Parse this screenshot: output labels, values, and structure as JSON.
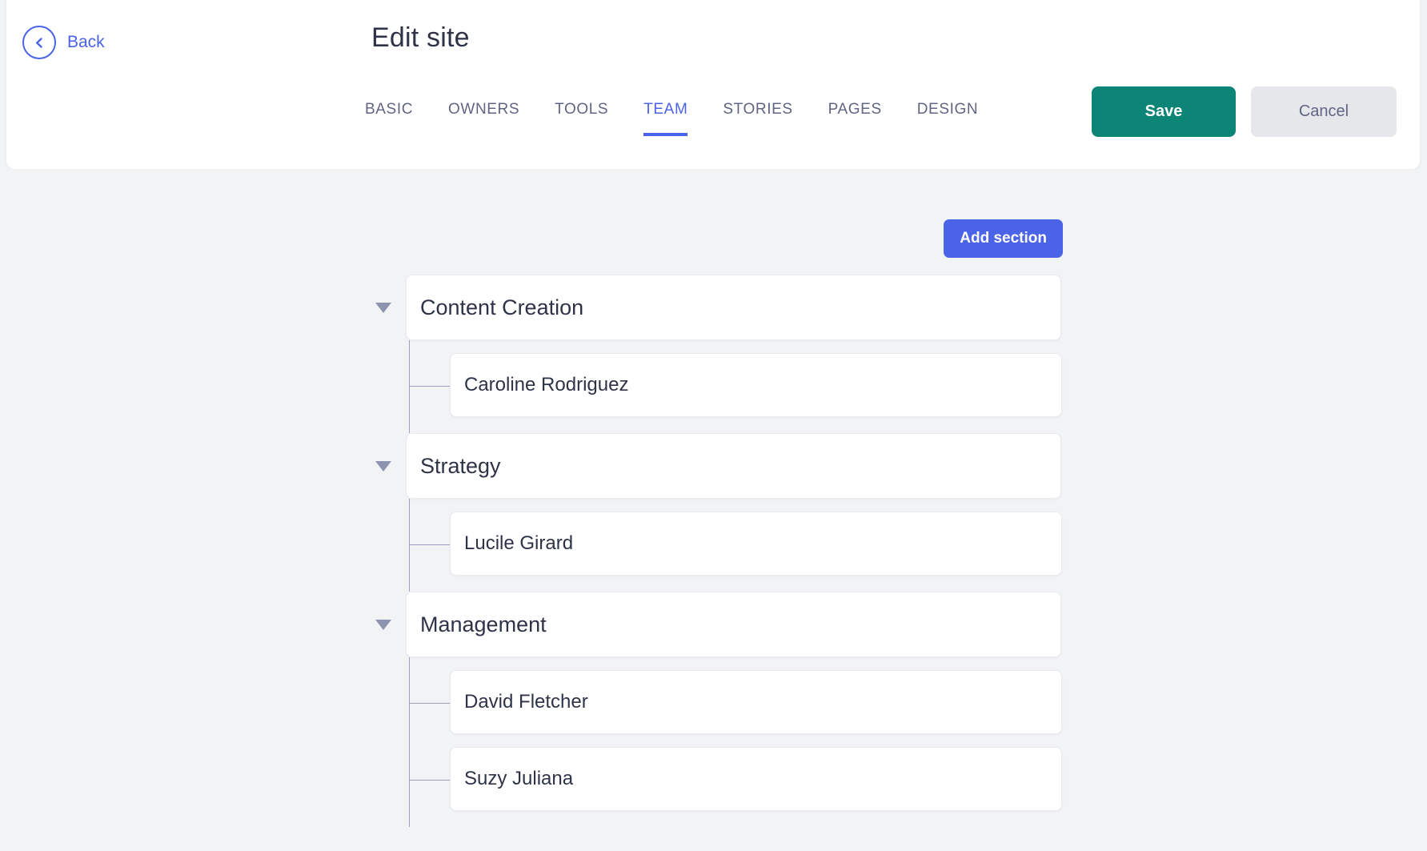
{
  "header": {
    "back_label": "Back",
    "back_icon": "chevron-left-circle-icon",
    "title": "Edit site",
    "tabs": [
      {
        "label": "BASIC",
        "active": false
      },
      {
        "label": "OWNERS",
        "active": false
      },
      {
        "label": "TOOLS",
        "active": false
      },
      {
        "label": "TEAM",
        "active": true
      },
      {
        "label": "STORIES",
        "active": false
      },
      {
        "label": "PAGES",
        "active": false
      },
      {
        "label": "DESIGN",
        "active": false
      }
    ],
    "save_label": "Save",
    "cancel_label": "Cancel"
  },
  "toolbar": {
    "add_section_label": "Add section"
  },
  "tree": {
    "caret_icon": "caret-down-icon",
    "sections": [
      {
        "title": "Content Creation",
        "expanded": true,
        "members": [
          {
            "name": "Caroline Rodriguez"
          }
        ]
      },
      {
        "title": "Strategy",
        "expanded": true,
        "members": [
          {
            "name": "Lucile Girard"
          }
        ]
      },
      {
        "title": "Management",
        "expanded": true,
        "members": [
          {
            "name": "David Fletcher"
          },
          {
            "name": "Suzy Juliana"
          }
        ]
      }
    ]
  },
  "colors": {
    "accent_blue": "#4a63e7",
    "save_teal": "#0c8476",
    "cancel_gray": "#e6e7eb",
    "page_bg": "#f2f3f5",
    "text_dark": "#2e3348",
    "text_muted": "#5f6582",
    "tree_line": "#9aa0bd"
  }
}
